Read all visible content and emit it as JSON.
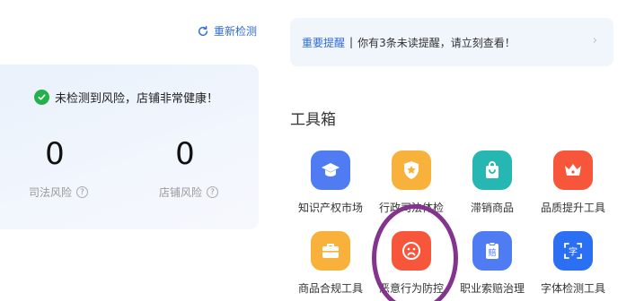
{
  "header": {
    "recheck_label": "重新检测",
    "recheck_icon": "refresh-icon"
  },
  "risk": {
    "status_text": "未检测到风险，店铺非常健康！",
    "status_icon": "check-circle-icon",
    "metrics": [
      {
        "value": "0",
        "label": "司法风险"
      },
      {
        "value": "0",
        "label": "店铺风险"
      }
    ]
  },
  "notice": {
    "label": "重要提醒",
    "separator": "|",
    "message": "你有3条未读提醒，请立刻查看！",
    "chevron": "›"
  },
  "toolbox": {
    "title": "工具箱",
    "items": [
      {
        "label": "知识产权市场",
        "icon": "graduation-cap-icon",
        "color": "#4f7cf3"
      },
      {
        "label": "行政司法体检",
        "icon": "shield-star-icon",
        "color": "#f8b13a"
      },
      {
        "label": "滞销商品",
        "icon": "shopping-bag-icon",
        "color": "#26b7b2"
      },
      {
        "label": "品质提升工具",
        "icon": "crown-icon",
        "color": "#f7563b"
      },
      {
        "label": "商品合规工具",
        "icon": "briefcase-icon",
        "color": "#f8b13a"
      },
      {
        "label": "恶意行为防控",
        "icon": "sad-face-icon",
        "color": "#f7563b"
      },
      {
        "label": "职业索赔治理",
        "icon": "clipboard-compensation-icon",
        "color": "#4f7cf3"
      },
      {
        "label": "字体检测工具",
        "icon": "font-scan-icon",
        "color": "#2b6ff2"
      }
    ]
  },
  "colors": {
    "accent": "#2f6bd9",
    "success": "#25b04b",
    "highlight": "#84348e"
  },
  "glyphs": {
    "help": "?",
    "compensation": "赔",
    "font": "字"
  }
}
